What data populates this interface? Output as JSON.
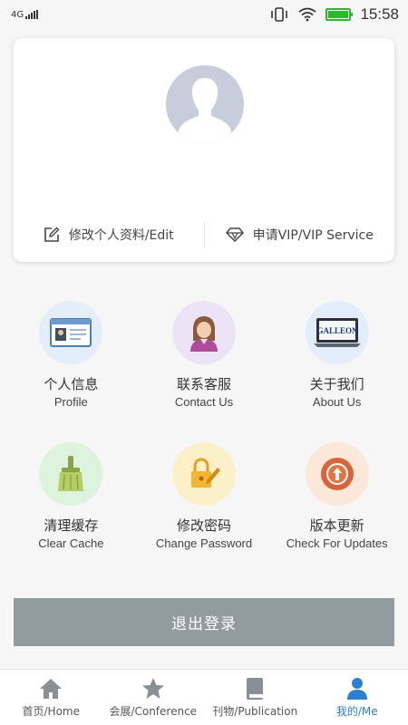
{
  "status_bar": {
    "network": "4G",
    "time": "15:58"
  },
  "profile": {
    "edit_label": "修改个人资料/Edit",
    "vip_label": "申请VIP/VIP Service"
  },
  "menu": [
    {
      "cn": "个人信息",
      "en": "Profile",
      "icon": "id-card-icon",
      "bg": "#e3eefa"
    },
    {
      "cn": "联系客服",
      "en": "Contact Us",
      "icon": "support-agent-icon",
      "bg": "#ece4f6"
    },
    {
      "cn": "关于我们",
      "en": "About Us",
      "icon": "about-screen-icon",
      "bg": "#e3eefa"
    },
    {
      "cn": "清理缓存",
      "en": "Clear Cache",
      "icon": "broom-icon",
      "bg": "#ddf3dd"
    },
    {
      "cn": "修改密码",
      "en": "Change Password",
      "icon": "lock-pen-icon",
      "bg": "#fbf0c8"
    },
    {
      "cn": "版本更新",
      "en": "Check For Updates",
      "icon": "update-arrow-icon",
      "bg": "#fbe8d8"
    }
  ],
  "about_logo_text": "GALLEON",
  "logout_label": "退出登录",
  "nav": [
    {
      "label": "首页/Home",
      "icon": "home-icon"
    },
    {
      "label": "会展/Conference",
      "icon": "star-icon"
    },
    {
      "label": "刊物/Publication",
      "icon": "book-icon"
    },
    {
      "label": "我的/Me",
      "icon": "person-icon",
      "active": true
    }
  ]
}
